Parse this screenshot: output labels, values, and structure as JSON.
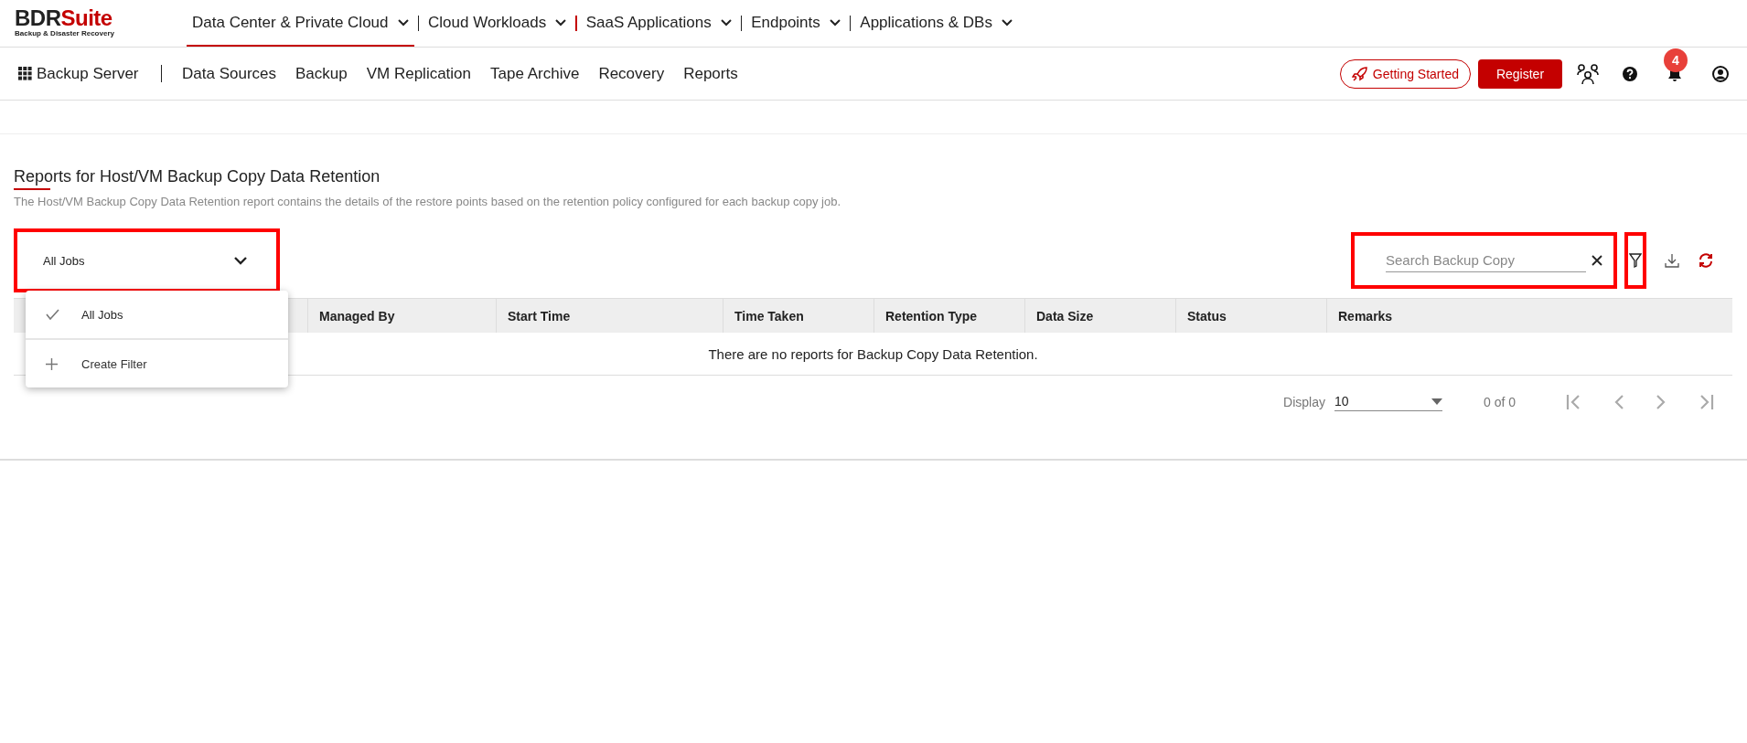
{
  "logo": {
    "name": "BDRSuite",
    "tagline": "Backup & Disaster Recovery"
  },
  "top_nav": [
    {
      "label": "Data Center & Private Cloud",
      "selected": true
    },
    {
      "label": "Cloud Workloads",
      "selected": false
    },
    {
      "label": "SaaS Applications",
      "selected": false
    },
    {
      "label": "Endpoints",
      "selected": false
    },
    {
      "label": "Applications & DBs",
      "selected": false
    }
  ],
  "sub_nav": {
    "product": "Backup Server",
    "items": [
      "Data Sources",
      "Backup",
      "VM Replication",
      "Tape Archive",
      "Recovery",
      "Reports"
    ]
  },
  "header_actions": {
    "getting_started": "Getting Started",
    "register": "Register",
    "notification_count": "4"
  },
  "page": {
    "title": "Reports for Host/VM Backup Copy Data Retention",
    "description": "The Host/VM Backup Copy Data Retention report contains the details of the restore points based on the retention policy configured for each backup copy job."
  },
  "job_filter": {
    "value": "All Jobs",
    "expanded": true,
    "options": [
      {
        "kind": "option",
        "label": "All Jobs",
        "selected": true
      },
      {
        "kind": "action",
        "label": "Create Filter",
        "selected": false
      }
    ]
  },
  "search": {
    "placeholder": "Search Backup Copy"
  },
  "table": {
    "columns": [
      "Managed By",
      "Start Time",
      "Time Taken",
      "Retention Type",
      "Data Size",
      "Status",
      "Remarks"
    ],
    "empty_message": "There are no reports for Backup Copy Data Retention."
  },
  "pagination": {
    "display_label": "Display",
    "page_size": "10",
    "range": "0 of 0"
  }
}
